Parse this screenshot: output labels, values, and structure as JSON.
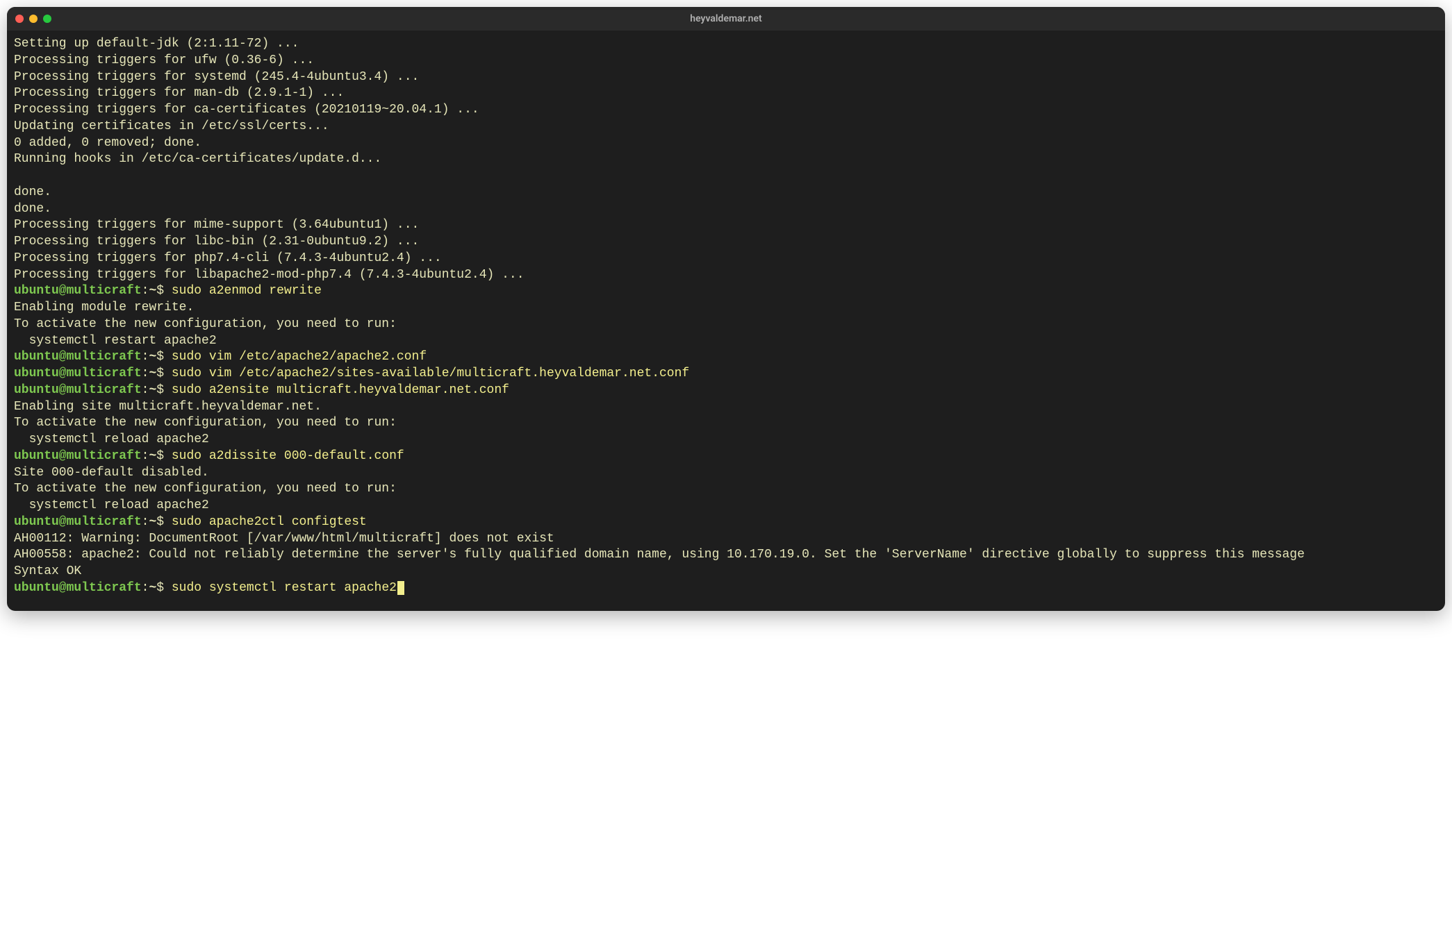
{
  "window": {
    "title": "heyvaldemar.net"
  },
  "colors": {
    "bg": "#1e1e1e",
    "titlebar": "#2a2a2a",
    "text_default": "#e6e6b8",
    "text_prompt": "#7ec850",
    "text_command": "#f2ee8d",
    "red": "#ff5f56",
    "yellow": "#ffbd2e",
    "green": "#27c93f"
  },
  "prompt": {
    "userhost": "ubuntu@multicraft",
    "sep": ":",
    "path": "~",
    "symbol": "$"
  },
  "lines": [
    {
      "type": "out",
      "text": "Setting up default-jdk (2:1.11-72) ..."
    },
    {
      "type": "out",
      "text": "Processing triggers for ufw (0.36-6) ..."
    },
    {
      "type": "out",
      "text": "Processing triggers for systemd (245.4-4ubuntu3.4) ..."
    },
    {
      "type": "out",
      "text": "Processing triggers for man-db (2.9.1-1) ..."
    },
    {
      "type": "out",
      "text": "Processing triggers for ca-certificates (20210119~20.04.1) ..."
    },
    {
      "type": "out",
      "text": "Updating certificates in /etc/ssl/certs..."
    },
    {
      "type": "out",
      "text": "0 added, 0 removed; done."
    },
    {
      "type": "out",
      "text": "Running hooks in /etc/ca-certificates/update.d..."
    },
    {
      "type": "out",
      "text": ""
    },
    {
      "type": "out",
      "text": "done."
    },
    {
      "type": "out",
      "text": "done."
    },
    {
      "type": "out",
      "text": "Processing triggers for mime-support (3.64ubuntu1) ..."
    },
    {
      "type": "out",
      "text": "Processing triggers for libc-bin (2.31-0ubuntu9.2) ..."
    },
    {
      "type": "out",
      "text": "Processing triggers for php7.4-cli (7.4.3-4ubuntu2.4) ..."
    },
    {
      "type": "out",
      "text": "Processing triggers for libapache2-mod-php7.4 (7.4.3-4ubuntu2.4) ..."
    },
    {
      "type": "cmd",
      "text": "sudo a2enmod rewrite"
    },
    {
      "type": "out",
      "text": "Enabling module rewrite."
    },
    {
      "type": "out",
      "text": "To activate the new configuration, you need to run:"
    },
    {
      "type": "out",
      "text": "  systemctl restart apache2"
    },
    {
      "type": "cmd",
      "text": "sudo vim /etc/apache2/apache2.conf"
    },
    {
      "type": "cmd",
      "text": "sudo vim /etc/apache2/sites-available/multicraft.heyvaldemar.net.conf"
    },
    {
      "type": "cmd",
      "text": "sudo a2ensite multicraft.heyvaldemar.net.conf"
    },
    {
      "type": "out",
      "text": "Enabling site multicraft.heyvaldemar.net."
    },
    {
      "type": "out",
      "text": "To activate the new configuration, you need to run:"
    },
    {
      "type": "out",
      "text": "  systemctl reload apache2"
    },
    {
      "type": "cmd",
      "text": "sudo a2dissite 000-default.conf"
    },
    {
      "type": "out",
      "text": "Site 000-default disabled."
    },
    {
      "type": "out",
      "text": "To activate the new configuration, you need to run:"
    },
    {
      "type": "out",
      "text": "  systemctl reload apache2"
    },
    {
      "type": "cmd",
      "text": "sudo apache2ctl configtest"
    },
    {
      "type": "out",
      "text": "AH00112: Warning: DocumentRoot [/var/www/html/multicraft] does not exist"
    },
    {
      "type": "out",
      "text": "AH00558: apache2: Could not reliably determine the server's fully qualified domain name, using 10.170.19.0. Set the 'ServerName' directive globally to suppress this message"
    },
    {
      "type": "out",
      "text": "Syntax OK"
    },
    {
      "type": "cmd",
      "text": "sudo systemctl restart apache2",
      "cursor": true
    }
  ]
}
